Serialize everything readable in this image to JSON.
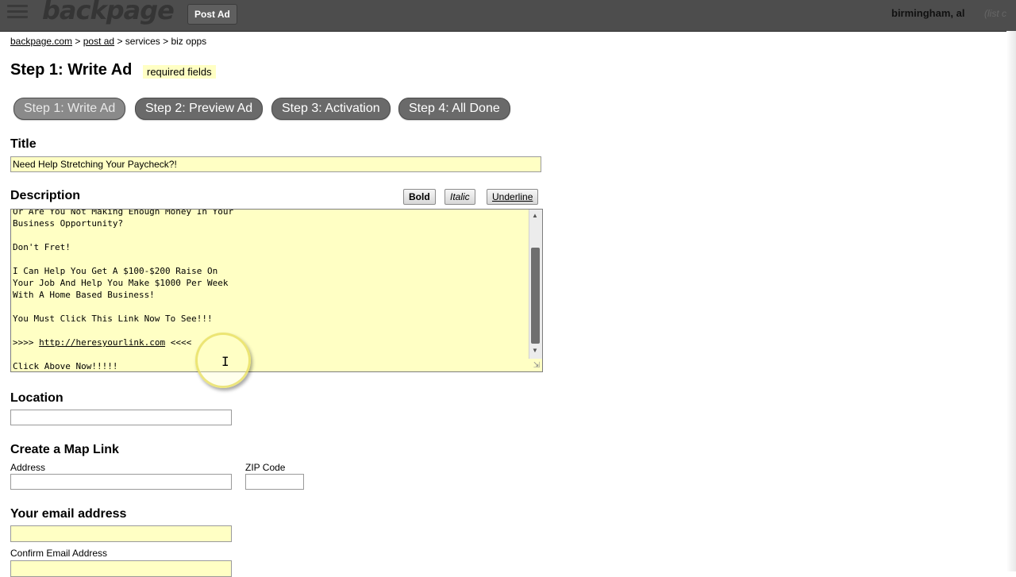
{
  "header": {
    "logo": "backpage",
    "post_ad_label": "Post Ad",
    "city": "birmingham, al",
    "city_link": "(list c"
  },
  "breadcrumb": {
    "home": "backpage.com",
    "sep": " > ",
    "post_ad": "post ad",
    "rest": " > services > biz opps"
  },
  "page": {
    "title": "Step 1: Write Ad",
    "required_note": "required fields"
  },
  "steps": [
    {
      "label": "Step 1: Write Ad"
    },
    {
      "label": "Step 2: Preview Ad"
    },
    {
      "label": "Step 3: Activation"
    },
    {
      "label": "Step 4: All Done"
    }
  ],
  "form": {
    "title_label": "Title",
    "title_value": "Need Help Stretching Your Paycheck?!",
    "description_label": "Description",
    "format_buttons": {
      "bold": "Bold",
      "italic": "Italic",
      "underline": "Underline"
    },
    "description_lines": [
      "Or Are You Not Making Enough Money In Your",
      "Business Opportunity?",
      "",
      "Don't Fret!",
      "",
      "I Can Help You Get A $100-$200 Raise On",
      "Your Job And Help You Make $1000 Per Week",
      "With A Home Based Business!",
      "",
      "You Must Click This Link Now To See!!!",
      "",
      ">>>> http://heresyourlink.com <<<<",
      "",
      "Click Above Now!!!!!"
    ],
    "location_label": "Location",
    "location_value": "",
    "map_link_label": "Create a Map Link",
    "address_label": "Address",
    "zip_label": "ZIP Code",
    "email_label": "Your email address",
    "confirm_email_label": "Confirm Email Address"
  },
  "colors": {
    "required_field_bg": "#ffffc4",
    "header_bg": "#4d4d4d",
    "step_button_bg": "#6a6a6a"
  },
  "icons": {
    "menu": "hamburger-menu-icon",
    "scroll_up": "triangle-up",
    "scroll_down": "triangle-down",
    "resize": "resize-grip"
  }
}
